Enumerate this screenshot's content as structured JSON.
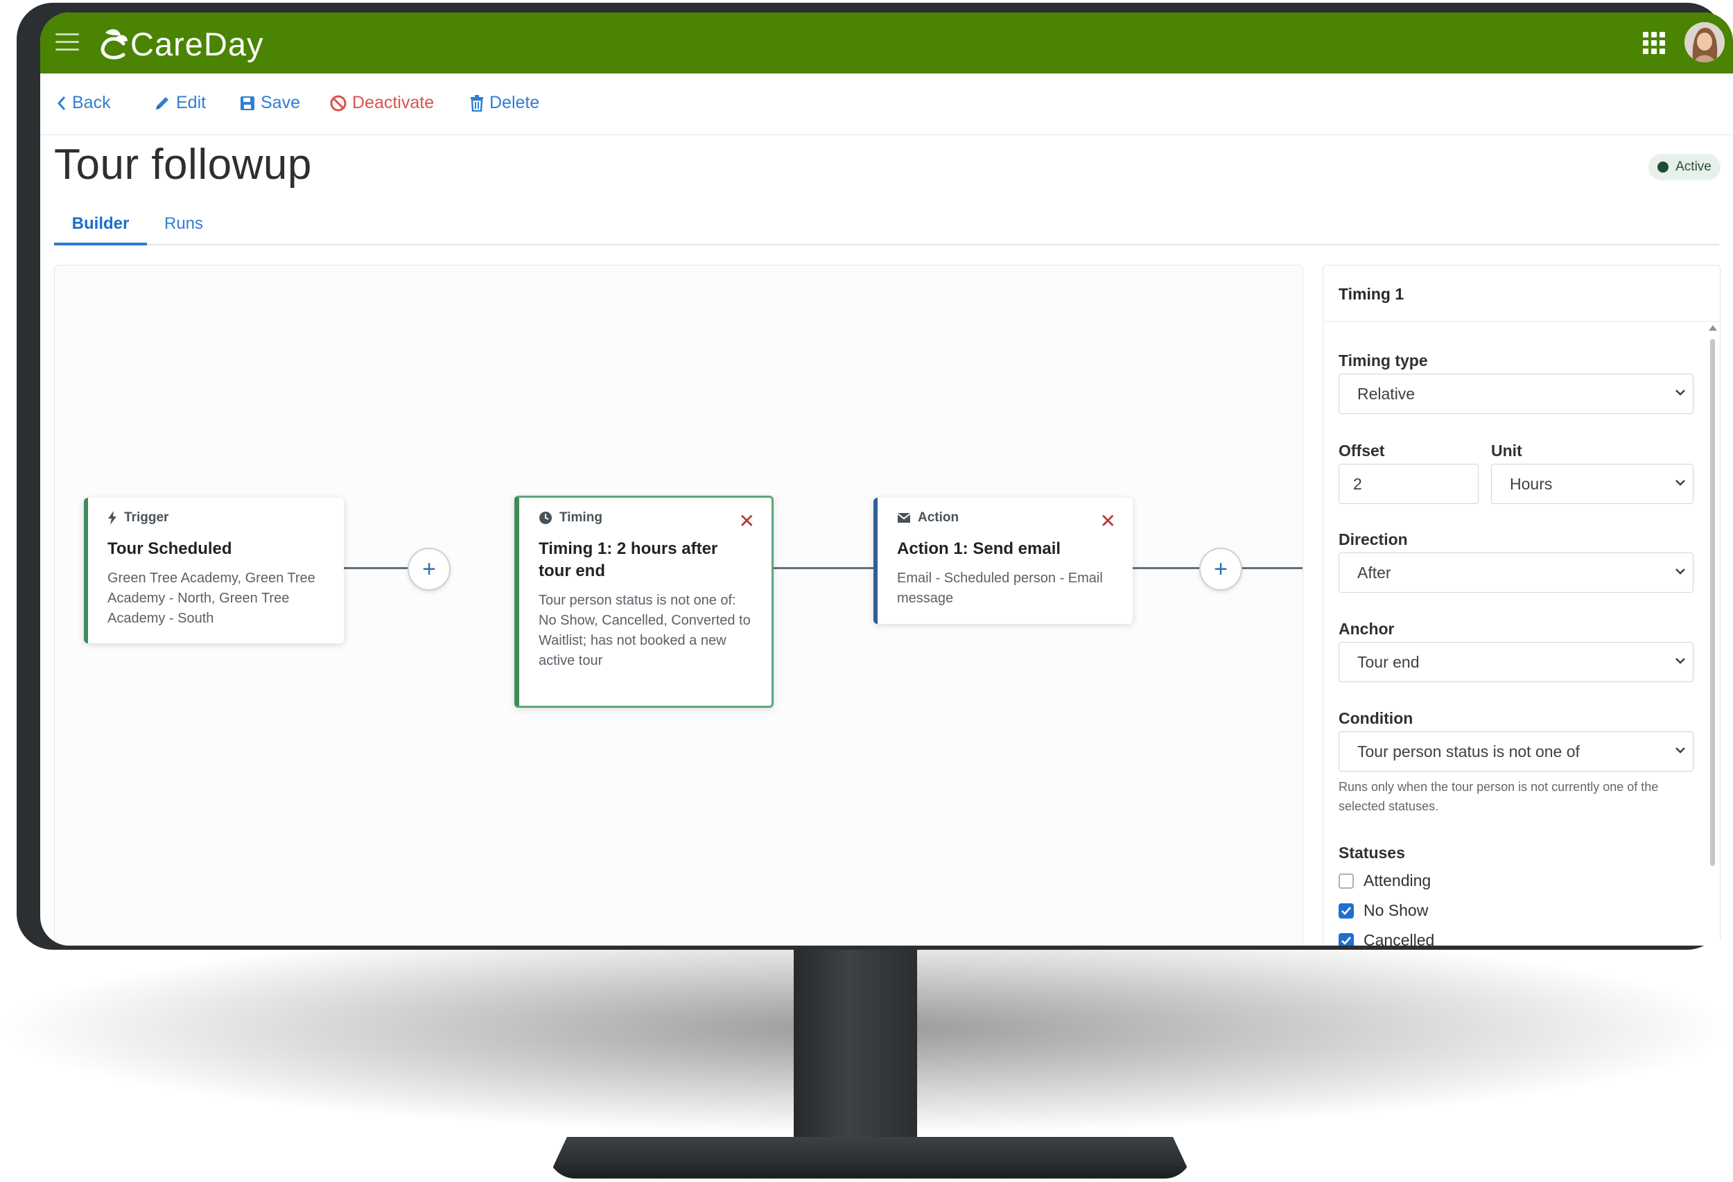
{
  "app": {
    "name": "CareDay"
  },
  "toolbar": {
    "back": "Back",
    "edit": "Edit",
    "save": "Save",
    "deactivate": "Deactivate",
    "delete": "Delete"
  },
  "page": {
    "title": "Tour followup",
    "status": "Active"
  },
  "tabs": [
    {
      "label": "Builder",
      "active": true
    },
    {
      "label": "Runs",
      "active": false
    }
  ],
  "workflow": {
    "nodes": [
      {
        "kind": "Trigger",
        "title": "Tour Scheduled",
        "description": "Green Tree Academy, Green Tree Academy - North, Green Tree Academy - South"
      },
      {
        "kind": "Timing",
        "title": "Timing 1: 2 hours after tour end",
        "description": "Tour person status is not one of: No Show, Cancelled, Converted to Waitlist; has not booked a new active tour"
      },
      {
        "kind": "Action",
        "title": "Action 1: Send email",
        "description": "Email - Scheduled person - Email message"
      }
    ],
    "add_step_label": "+"
  },
  "panel": {
    "title": "Timing 1",
    "timing_type": {
      "label": "Timing type",
      "value": "Relative"
    },
    "offset": {
      "label": "Offset",
      "value": "2"
    },
    "unit": {
      "label": "Unit",
      "value": "Hours"
    },
    "direction": {
      "label": "Direction",
      "value": "After"
    },
    "anchor": {
      "label": "Anchor",
      "value": "Tour end"
    },
    "condition": {
      "label": "Condition",
      "value": "Tour person status is not one of",
      "help": "Runs only when the tour person is not currently one of the selected statuses."
    },
    "statuses": {
      "label": "Statuses",
      "items": [
        {
          "label": "Attending",
          "checked": false
        },
        {
          "label": "No Show",
          "checked": true
        },
        {
          "label": "Cancelled",
          "checked": true
        }
      ]
    }
  },
  "colors": {
    "brand_green": "#4a8402",
    "link_blue": "#2f7fd3",
    "danger_red": "#d9534f",
    "trigger_accent": "#3e8b5b",
    "action_accent": "#2e5f96"
  },
  "icons": {
    "menu": "hamburger-icon",
    "apps": "grid-icon",
    "back": "chevron-left-icon",
    "edit": "pencil-icon",
    "save": "floppy-icon",
    "deactivate": "ban-icon",
    "delete": "trash-icon",
    "trigger": "bolt-icon",
    "timing": "clock-icon",
    "action": "envelope-icon"
  }
}
